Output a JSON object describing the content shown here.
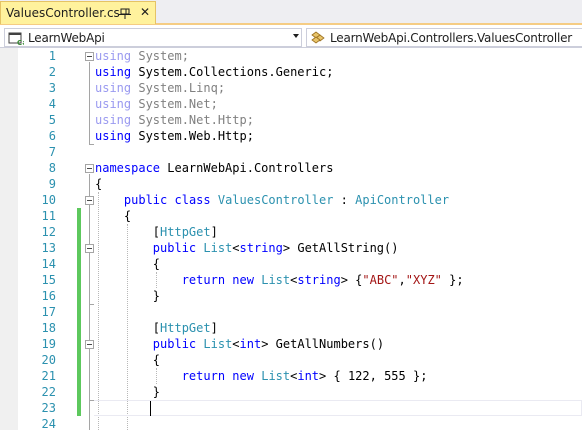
{
  "tab": {
    "label": "ValuesController.cs",
    "close_glyph": "✕"
  },
  "navbar": {
    "project": "LearnWebApi",
    "class_path": "LearnWebApi.Controllers.ValuesController"
  },
  "colors": {
    "keyword": "#0000ff",
    "type": "#2b91af",
    "string": "#a31515",
    "line_number": "#2b91af",
    "change_bar": "#5dc85d",
    "tab_background": "#fff29d"
  },
  "icons": {
    "tab_pin": "pin-icon",
    "tab_close": "close-icon",
    "project": "csharp-project-icon",
    "class": "class-icon"
  },
  "lines": [
    {
      "number": "1",
      "tokens": [
        {
          "kind": "using-dim",
          "text": "using"
        },
        {
          "kind": "gray",
          "text": " System;"
        }
      ]
    },
    {
      "number": "2",
      "tokens": [
        {
          "kind": "kw",
          "text": "using"
        },
        {
          "kind": "plain",
          "text": " System.Collections.Generic;"
        }
      ]
    },
    {
      "number": "3",
      "tokens": [
        {
          "kind": "using-dim",
          "text": "using"
        },
        {
          "kind": "gray",
          "text": " System.Linq;"
        }
      ]
    },
    {
      "number": "4",
      "tokens": [
        {
          "kind": "using-dim",
          "text": "using"
        },
        {
          "kind": "gray",
          "text": " System.Net;"
        }
      ]
    },
    {
      "number": "5",
      "tokens": [
        {
          "kind": "using-dim",
          "text": "using"
        },
        {
          "kind": "gray",
          "text": " System.Net.Http;"
        }
      ]
    },
    {
      "number": "6",
      "tokens": [
        {
          "kind": "kw",
          "text": "using"
        },
        {
          "kind": "plain",
          "text": " System.Web.Http;"
        }
      ]
    },
    {
      "number": "7",
      "tokens": []
    },
    {
      "number": "8",
      "tokens": [
        {
          "kind": "kw",
          "text": "namespace"
        },
        {
          "kind": "plain",
          "text": " LearnWebApi.Controllers"
        }
      ]
    },
    {
      "number": "9",
      "tokens": [
        {
          "kind": "plain",
          "text": "{"
        }
      ]
    },
    {
      "number": "10",
      "tokens": [
        {
          "kind": "plain",
          "text": "    "
        },
        {
          "kind": "kw",
          "text": "public"
        },
        {
          "kind": "plain",
          "text": " "
        },
        {
          "kind": "kw",
          "text": "class"
        },
        {
          "kind": "plain",
          "text": " "
        },
        {
          "kind": "type",
          "text": "ValuesController"
        },
        {
          "kind": "plain",
          "text": " : "
        },
        {
          "kind": "type",
          "text": "ApiController"
        }
      ]
    },
    {
      "number": "11",
      "tokens": [
        {
          "kind": "plain",
          "text": "    {"
        }
      ]
    },
    {
      "number": "12",
      "tokens": [
        {
          "kind": "plain",
          "text": "        ["
        },
        {
          "kind": "type",
          "text": "HttpGet"
        },
        {
          "kind": "plain",
          "text": "]"
        }
      ]
    },
    {
      "number": "13",
      "tokens": [
        {
          "kind": "plain",
          "text": "        "
        },
        {
          "kind": "kw",
          "text": "public"
        },
        {
          "kind": "plain",
          "text": " "
        },
        {
          "kind": "type",
          "text": "List"
        },
        {
          "kind": "plain",
          "text": "<"
        },
        {
          "kind": "kw",
          "text": "string"
        },
        {
          "kind": "plain",
          "text": "> GetAllString()"
        }
      ]
    },
    {
      "number": "14",
      "tokens": [
        {
          "kind": "plain",
          "text": "        {"
        }
      ]
    },
    {
      "number": "15",
      "tokens": [
        {
          "kind": "plain",
          "text": "            "
        },
        {
          "kind": "kw",
          "text": "return"
        },
        {
          "kind": "plain",
          "text": " "
        },
        {
          "kind": "kw",
          "text": "new"
        },
        {
          "kind": "plain",
          "text": " "
        },
        {
          "kind": "type",
          "text": "List"
        },
        {
          "kind": "plain",
          "text": "<"
        },
        {
          "kind": "kw",
          "text": "string"
        },
        {
          "kind": "plain",
          "text": "> {"
        },
        {
          "kind": "str",
          "text": "\"ABC\""
        },
        {
          "kind": "plain",
          "text": ","
        },
        {
          "kind": "str",
          "text": "\"XYZ\""
        },
        {
          "kind": "plain",
          "text": " };"
        }
      ]
    },
    {
      "number": "16",
      "tokens": [
        {
          "kind": "plain",
          "text": "        }"
        }
      ]
    },
    {
      "number": "17",
      "tokens": []
    },
    {
      "number": "18",
      "tokens": [
        {
          "kind": "plain",
          "text": "        ["
        },
        {
          "kind": "type",
          "text": "HttpGet"
        },
        {
          "kind": "plain",
          "text": "]"
        }
      ]
    },
    {
      "number": "19",
      "tokens": [
        {
          "kind": "plain",
          "text": "        "
        },
        {
          "kind": "kw",
          "text": "public"
        },
        {
          "kind": "plain",
          "text": " "
        },
        {
          "kind": "type",
          "text": "List"
        },
        {
          "kind": "plain",
          "text": "<"
        },
        {
          "kind": "kw",
          "text": "int"
        },
        {
          "kind": "plain",
          "text": "> GetAllNumbers()"
        }
      ]
    },
    {
      "number": "20",
      "tokens": [
        {
          "kind": "plain",
          "text": "        {"
        }
      ]
    },
    {
      "number": "21",
      "tokens": [
        {
          "kind": "plain",
          "text": "            "
        },
        {
          "kind": "kw",
          "text": "return"
        },
        {
          "kind": "plain",
          "text": " "
        },
        {
          "kind": "kw",
          "text": "new"
        },
        {
          "kind": "plain",
          "text": " "
        },
        {
          "kind": "type",
          "text": "List"
        },
        {
          "kind": "plain",
          "text": "<"
        },
        {
          "kind": "kw",
          "text": "int"
        },
        {
          "kind": "plain",
          "text": "> { 122, 555 };"
        }
      ]
    },
    {
      "number": "22",
      "tokens": [
        {
          "kind": "plain",
          "text": "        }"
        }
      ]
    },
    {
      "number": "23",
      "tokens": []
    },
    {
      "number": "24",
      "tokens": []
    }
  ]
}
